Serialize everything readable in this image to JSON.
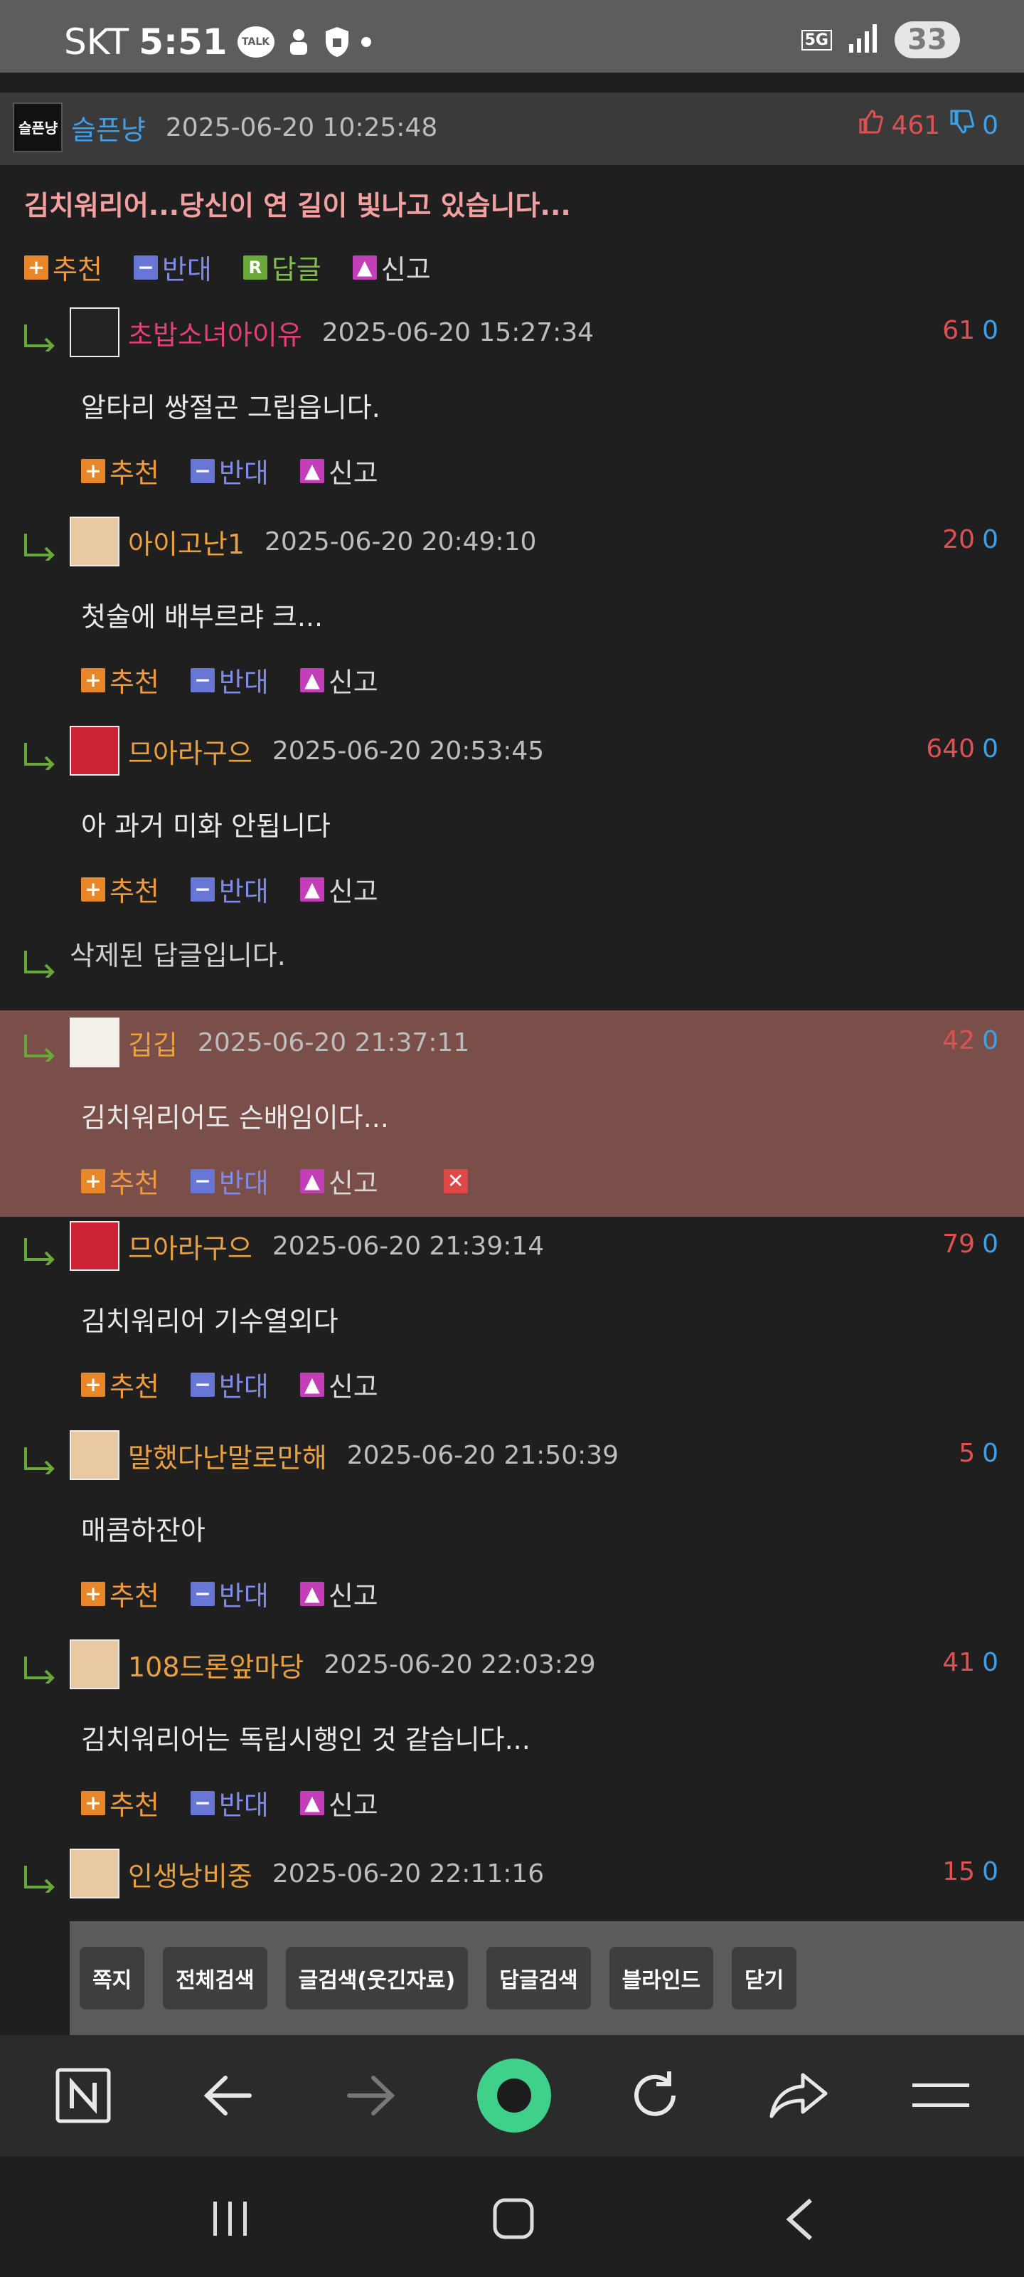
{
  "status_bar": {
    "carrier": "SKT",
    "time": "5:51",
    "talk_badge": "TALK",
    "network": "5G",
    "battery": "33"
  },
  "comments": [
    {
      "author": "슬픈냥",
      "date": "2025-06-20 10:25:48",
      "up": "461",
      "down": "0",
      "text": "김치워리어...당신이 연 길이 빛나고 있습니다..."
    },
    {
      "author": "초밥소녀아이유",
      "date": "2025-06-20 15:27:34",
      "up": "61",
      "down": "0",
      "text": "알타리 쌍절곤 그립읍니다."
    },
    {
      "author": "아이고난1",
      "date": "2025-06-20 20:49:10",
      "up": "20",
      "down": "0",
      "text": "첫술에 배부르랴 크..."
    },
    {
      "author": "므아라구으",
      "date": "2025-06-20 20:53:45",
      "up": "640",
      "down": "0",
      "text": "아 과거 미화 안됩니다"
    },
    {
      "deleted_text": "삭제된 답글입니다."
    },
    {
      "author": "깁깁",
      "date": "2025-06-20 21:37:11",
      "up": "42",
      "down": "0",
      "text": "김치워리어도 슨배임이다..."
    },
    {
      "author": "므아라구으",
      "date": "2025-06-20 21:39:14",
      "up": "79",
      "down": "0",
      "text": "김치워리어 기수열외다"
    },
    {
      "author": "말했다난말로만해",
      "date": "2025-06-20 21:50:39",
      "up": "5",
      "down": "0",
      "text": "매콤하잔아"
    },
    {
      "author": "108드론앞마당",
      "date": "2025-06-20 22:03:29",
      "up": "41",
      "down": "0",
      "text": "김치워리어는 독립시행인 것 같습니다..."
    },
    {
      "author": "인생낭비중",
      "date": "2025-06-20 22:11:16",
      "up": "15",
      "down": "0"
    }
  ],
  "actions": {
    "recommend": "추천",
    "oppose": "반대",
    "reply": "답글",
    "report": "신고",
    "reply_badge": "R"
  },
  "toolbar": [
    "쪽지",
    "전체검색",
    "글검색(웃긴자료)",
    "답글검색",
    "블라인드",
    "닫기"
  ],
  "colors": {
    "background": "#1f1f1f",
    "highlight_row": "#7a4f4a",
    "up_vote": "#e05050",
    "down_vote": "#3ea0e8",
    "recommend": "#f09a40",
    "oppose": "#7d8ae8"
  },
  "icons": [
    "naver-icon",
    "back-icon",
    "forward-icon",
    "home-circle-icon",
    "refresh-icon",
    "share-icon",
    "menu-icon",
    "recent-apps-icon",
    "home-icon",
    "system-back-icon"
  ]
}
